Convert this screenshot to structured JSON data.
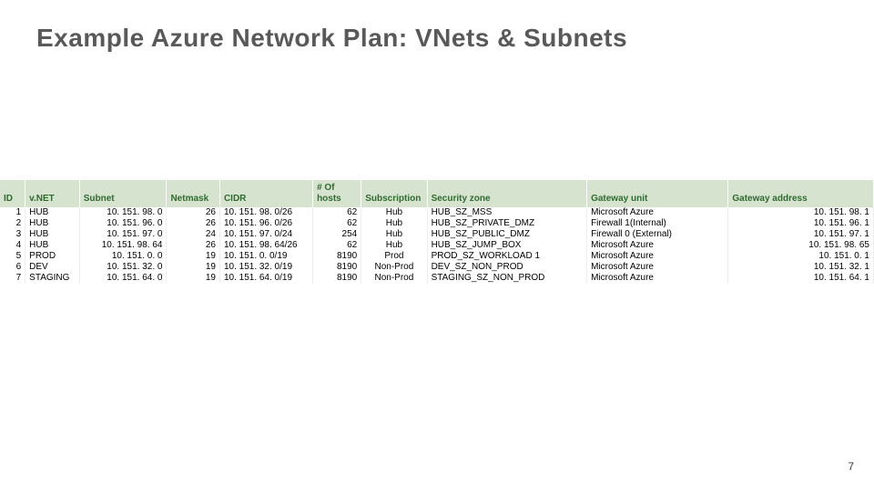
{
  "title": "Example Azure Network Plan: VNets & Subnets",
  "page_number": "7",
  "columns": {
    "id": "ID",
    "vnet": "v.NET",
    "subnet": "Subnet",
    "netmask": "Netmask",
    "cidr": "CIDR",
    "hosts": "# Of hosts",
    "sub": "Subscription",
    "zone": "Security zone",
    "gw": "Gateway unit",
    "gwa": "Gateway address"
  },
  "rows": [
    {
      "id": "1",
      "vnet": "HUB",
      "subnet": "10. 151. 98. 0",
      "netmask": "26",
      "cidr": "10. 151. 98. 0/26",
      "hosts": "62",
      "sub": "Hub",
      "zone": "HUB_SZ_MSS",
      "gw": "Microsoft Azure",
      "gwa": "10. 151. 98. 1"
    },
    {
      "id": "2",
      "vnet": "HUB",
      "subnet": "10. 151. 96. 0",
      "netmask": "26",
      "cidr": "10. 151. 96. 0/26",
      "hosts": "62",
      "sub": "Hub",
      "zone": "HUB_SZ_PRIVATE_DMZ",
      "gw": "Firewall 1(Internal)",
      "gwa": "10. 151. 96. 1"
    },
    {
      "id": "3",
      "vnet": "HUB",
      "subnet": "10. 151. 97. 0",
      "netmask": "24",
      "cidr": "10. 151. 97. 0/24",
      "hosts": "254",
      "sub": "Hub",
      "zone": "HUB_SZ_PUBLIC_DMZ",
      "gw": "Firewall 0 (External)",
      "gwa": "10. 151. 97. 1"
    },
    {
      "id": "4",
      "vnet": "HUB",
      "subnet": "10. 151. 98. 64",
      "netmask": "26",
      "cidr": "10. 151. 98. 64/26",
      "hosts": "62",
      "sub": "Hub",
      "zone": "HUB_SZ_JUMP_BOX",
      "gw": "Microsoft Azure",
      "gwa": "10. 151. 98. 65"
    },
    {
      "id": "5",
      "vnet": "PROD",
      "subnet": "10. 151. 0. 0",
      "netmask": "19",
      "cidr": "10. 151. 0. 0/19",
      "hosts": "8190",
      "sub": "Prod",
      "zone": "PROD_SZ_WORKLOAD 1",
      "gw": "Microsoft Azure",
      "gwa": "10. 151. 0. 1"
    },
    {
      "id": "6",
      "vnet": "DEV",
      "subnet": "10. 151. 32. 0",
      "netmask": "19",
      "cidr": "10. 151. 32. 0/19",
      "hosts": "8190",
      "sub": "Non-Prod",
      "zone": "DEV_SZ_NON_PROD",
      "gw": "Microsoft Azure",
      "gwa": "10. 151. 32. 1"
    },
    {
      "id": "7",
      "vnet": "STAGING",
      "subnet": "10. 151. 64. 0",
      "netmask": "19",
      "cidr": "10. 151. 64. 0/19",
      "hosts": "8190",
      "sub": "Non-Prod",
      "zone": "STAGING_SZ_NON_PROD",
      "gw": "Microsoft Azure",
      "gwa": "10. 151. 64. 1"
    }
  ],
  "chart_data": {
    "type": "table",
    "title": "Example Azure Network Plan: VNets & Subnets",
    "columns": [
      "ID",
      "v.NET",
      "Subnet",
      "Netmask",
      "CIDR",
      "# Of hosts",
      "Subscription",
      "Security zone",
      "Gateway unit",
      "Gateway address"
    ],
    "rows": [
      [
        1,
        "HUB",
        "10.151.98.0",
        26,
        "10.151.98.0/26",
        62,
        "Hub",
        "HUB_SZ_MSS",
        "Microsoft Azure",
        "10.151.98.1"
      ],
      [
        2,
        "HUB",
        "10.151.96.0",
        26,
        "10.151.96.0/26",
        62,
        "Hub",
        "HUB_SZ_PRIVATE_DMZ",
        "Firewall 1(Internal)",
        "10.151.96.1"
      ],
      [
        3,
        "HUB",
        "10.151.97.0",
        24,
        "10.151.97.0/24",
        254,
        "Hub",
        "HUB_SZ_PUBLIC_DMZ",
        "Firewall 0 (External)",
        "10.151.97.1"
      ],
      [
        4,
        "HUB",
        "10.151.98.64",
        26,
        "10.151.98.64/26",
        62,
        "Hub",
        "HUB_SZ_JUMP_BOX",
        "Microsoft Azure",
        "10.151.98.65"
      ],
      [
        5,
        "PROD",
        "10.151.0.0",
        19,
        "10.151.0.0/19",
        8190,
        "Prod",
        "PROD_SZ_WORKLOAD 1",
        "Microsoft Azure",
        "10.151.0.1"
      ],
      [
        6,
        "DEV",
        "10.151.32.0",
        19,
        "10.151.32.0/19",
        8190,
        "Non-Prod",
        "DEV_SZ_NON_PROD",
        "Microsoft Azure",
        "10.151.32.1"
      ],
      [
        7,
        "STAGING",
        "10.151.64.0",
        19,
        "10.151.64.0/19",
        8190,
        "Non-Prod",
        "STAGING_SZ_NON_PROD",
        "Microsoft Azure",
        "10.151.64.1"
      ]
    ]
  }
}
